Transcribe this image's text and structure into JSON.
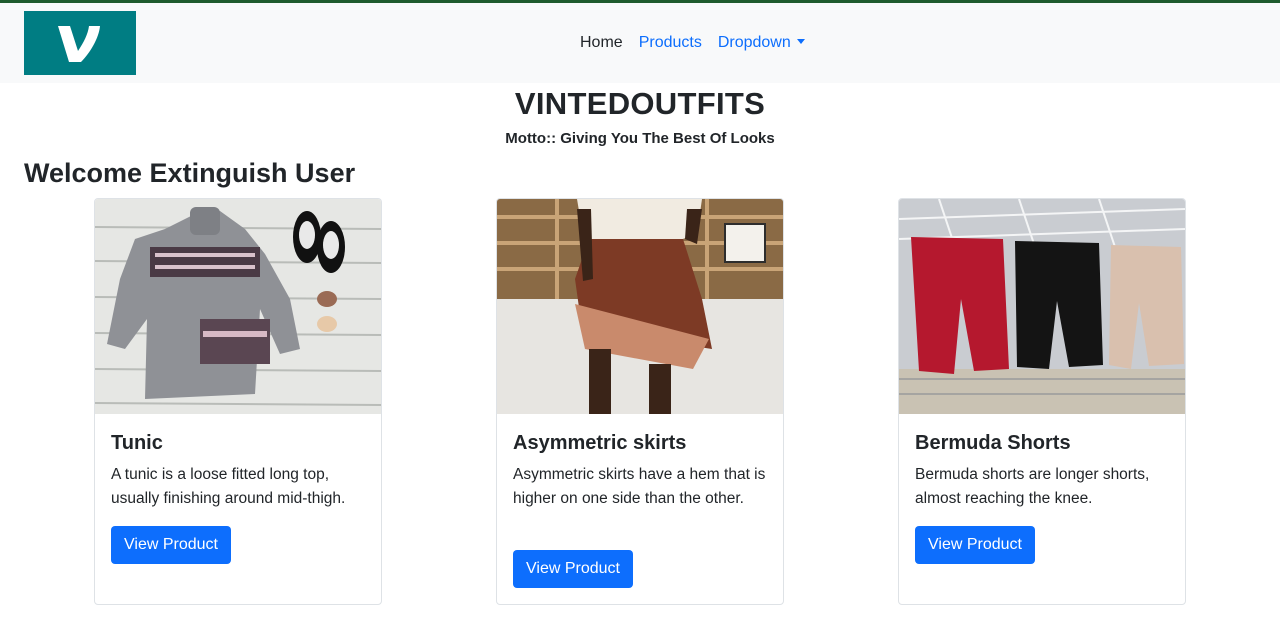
{
  "navbar": {
    "logo_alt": "V",
    "links": [
      {
        "label": "Home"
      },
      {
        "label": "Products"
      },
      {
        "label": "Dropdown"
      }
    ]
  },
  "brand": "VINTEDOUTFITS",
  "motto": "Motto:: Giving You The Best Of Looks",
  "welcome": "Welcome Extinguish User",
  "products": [
    {
      "title": "Tunic",
      "description": "A tunic is a loose fitted long top, usually finishing around mid-thigh.",
      "button": "View Product"
    },
    {
      "title": "Asymmetric skirts",
      "description": "Asymmetric skirts have a hem that is higher on one side than the other.",
      "button": "View Product"
    },
    {
      "title": "Bermuda Shorts",
      "description": "Bermuda shorts are longer shorts, almost reaching the knee.",
      "button": "View Product"
    }
  ],
  "colors": {
    "primary": "#0d6efd",
    "navbar_bg": "#f8f9fa",
    "logo_bg": "#007d83",
    "top_line": "#1e5b2e"
  }
}
